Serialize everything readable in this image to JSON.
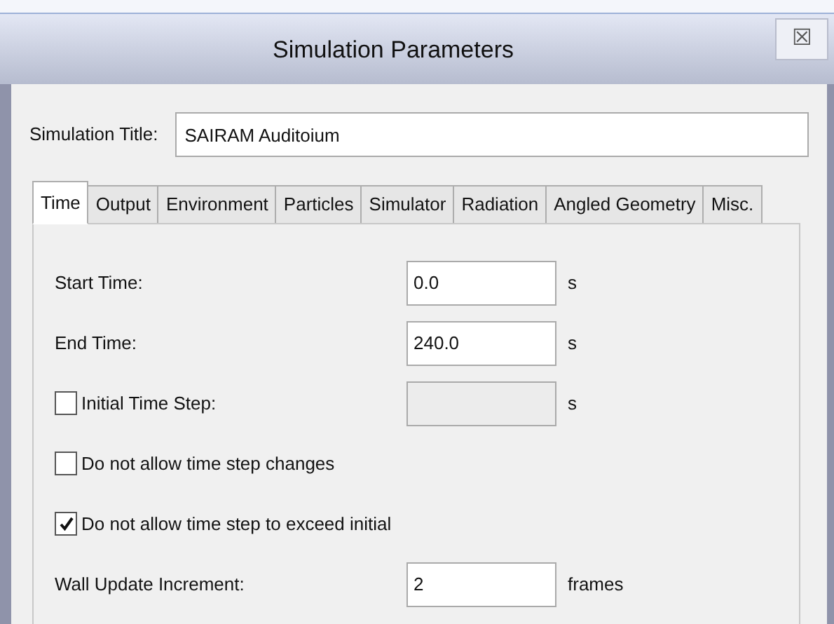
{
  "window": {
    "title": "Simulation Parameters",
    "close": "☒"
  },
  "simulation_title": {
    "label": "Simulation Title:",
    "value": "SAIRAM Auditoium"
  },
  "tabs": [
    {
      "label": "Time",
      "selected": true
    },
    {
      "label": "Output",
      "selected": false
    },
    {
      "label": "Environment",
      "selected": false
    },
    {
      "label": "Particles",
      "selected": false
    },
    {
      "label": "Simulator",
      "selected": false
    },
    {
      "label": "Radiation",
      "selected": false
    },
    {
      "label": "Angled Geometry",
      "selected": false
    },
    {
      "label": "Misc.",
      "selected": false
    }
  ],
  "rows": [
    {
      "kind": "field",
      "label": "Start Time:",
      "value": "0.0",
      "unit": "s"
    },
    {
      "kind": "field",
      "label": "End Time:",
      "value": "240.0",
      "unit": "s"
    },
    {
      "kind": "checkbox_field",
      "label": "Initial Time Step:",
      "unit": "s",
      "checked": false,
      "disabled": true
    },
    {
      "kind": "checkbox",
      "label": "Do not allow time step changes",
      "checked": false
    },
    {
      "kind": "checkbox",
      "label": "Do not allow time step to exceed initial",
      "checked": true
    },
    {
      "kind": "field",
      "label": "Wall Update Increment:",
      "value": "2",
      "unit": "frames"
    }
  ]
}
